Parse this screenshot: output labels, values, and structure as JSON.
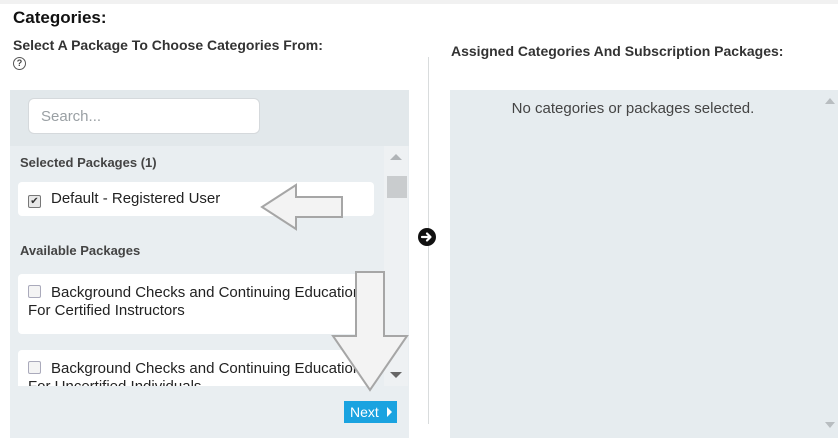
{
  "title": "Categories:",
  "left_heading": "Select A Package To Choose Categories From:",
  "right_heading": "Assigned Categories And Subscription Packages:",
  "search": {
    "placeholder": "Search..."
  },
  "sections": {
    "selected_label": "Selected Packages (1)",
    "available_label": "Available Packages"
  },
  "packages": {
    "selected": [
      {
        "label": "Default - Registered User",
        "checked": true
      }
    ],
    "available": [
      {
        "label": "Background Checks and Continuing Education For Certified Instructors",
        "checked": false
      },
      {
        "label": "Background Checks and Continuing Education For Uncertified Individuals",
        "checked": false
      }
    ]
  },
  "next_label": "Next",
  "empty_message": "No categories or packages selected.",
  "colors": {
    "accent": "#1aa3e0",
    "panel_bg": "#e9eef1",
    "right_panel_bg": "#e6ecef"
  },
  "icons": {
    "help": "help-circle-icon",
    "go": "arrow-right-circle-icon",
    "checkbox": "checkbox-icon"
  }
}
